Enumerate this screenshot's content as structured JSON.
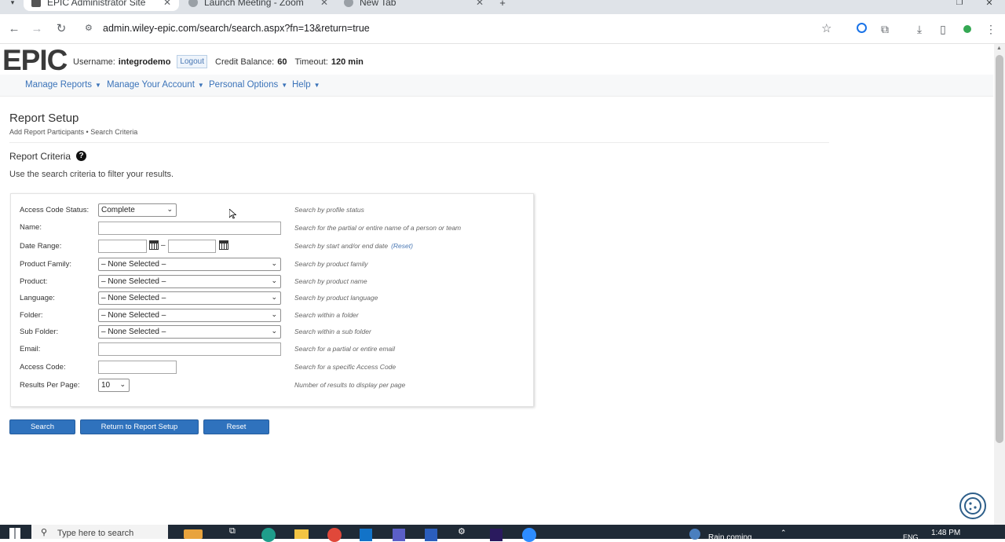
{
  "browser": {
    "tabs": [
      {
        "title": "EPIC Administrator Site",
        "active": true
      },
      {
        "title": "Launch Meeting - Zoom",
        "active": false
      },
      {
        "title": "New Tab",
        "active": false
      }
    ],
    "url": "admin.wiley-epic.com/search/search.aspx?fn=13&return=true"
  },
  "header": {
    "logo": "EPIC",
    "username_label": "Username:",
    "username": "integrodemo",
    "logout": "Logout",
    "credit_label": "Credit Balance:",
    "credit": "60",
    "timeout_label": "Timeout:",
    "timeout": "120 min"
  },
  "menu": {
    "items": [
      "Manage Reports",
      "Manage Your Account",
      "Personal Options",
      "Help"
    ]
  },
  "page": {
    "title": "Report Setup",
    "breadcrumb": "Add Report Participants • Search Criteria",
    "criteria_title": "Report Criteria",
    "subtitle": "Use the search criteria to filter your results."
  },
  "form": {
    "access_code_status": {
      "label": "Access Code Status:",
      "value": "Complete",
      "hint": "Search by profile status"
    },
    "name": {
      "label": "Name:",
      "value": "",
      "hint": "Search for the partial or entire name of a person or team"
    },
    "date_range": {
      "label": "Date Range:",
      "start": "",
      "end": "",
      "separator": "–",
      "hint": "Search by start and/or end date",
      "reset": "(Reset)"
    },
    "product_family": {
      "label": "Product Family:",
      "value": "– None Selected –",
      "hint": "Search by product family"
    },
    "product": {
      "label": "Product:",
      "value": "– None Selected –",
      "hint": "Search by product name"
    },
    "language": {
      "label": "Language:",
      "value": "– None Selected –",
      "hint": "Search by product language"
    },
    "folder": {
      "label": "Folder:",
      "value": "– None Selected –",
      "hint": "Search within a folder"
    },
    "sub_folder": {
      "label": "Sub Folder:",
      "value": "– None Selected –",
      "hint": "Search within a sub folder"
    },
    "email": {
      "label": "Email:",
      "value": "",
      "hint": "Search for a partial or entire email"
    },
    "access_code": {
      "label": "Access Code:",
      "value": "",
      "hint": "Search for a specific Access Code"
    },
    "results_per_page": {
      "label": "Results Per Page:",
      "value": "10",
      "hint": "Number of results to display per page"
    }
  },
  "buttons": {
    "search": "Search",
    "return": "Return to Report Setup",
    "reset": "Reset"
  },
  "taskbar": {
    "search_placeholder": "Type here to search",
    "weather": "Rain coming",
    "lang": "ENG",
    "time": "1:48 PM"
  },
  "colors": {
    "primary_button": "#2f72bd",
    "link": "#3b73b9"
  }
}
